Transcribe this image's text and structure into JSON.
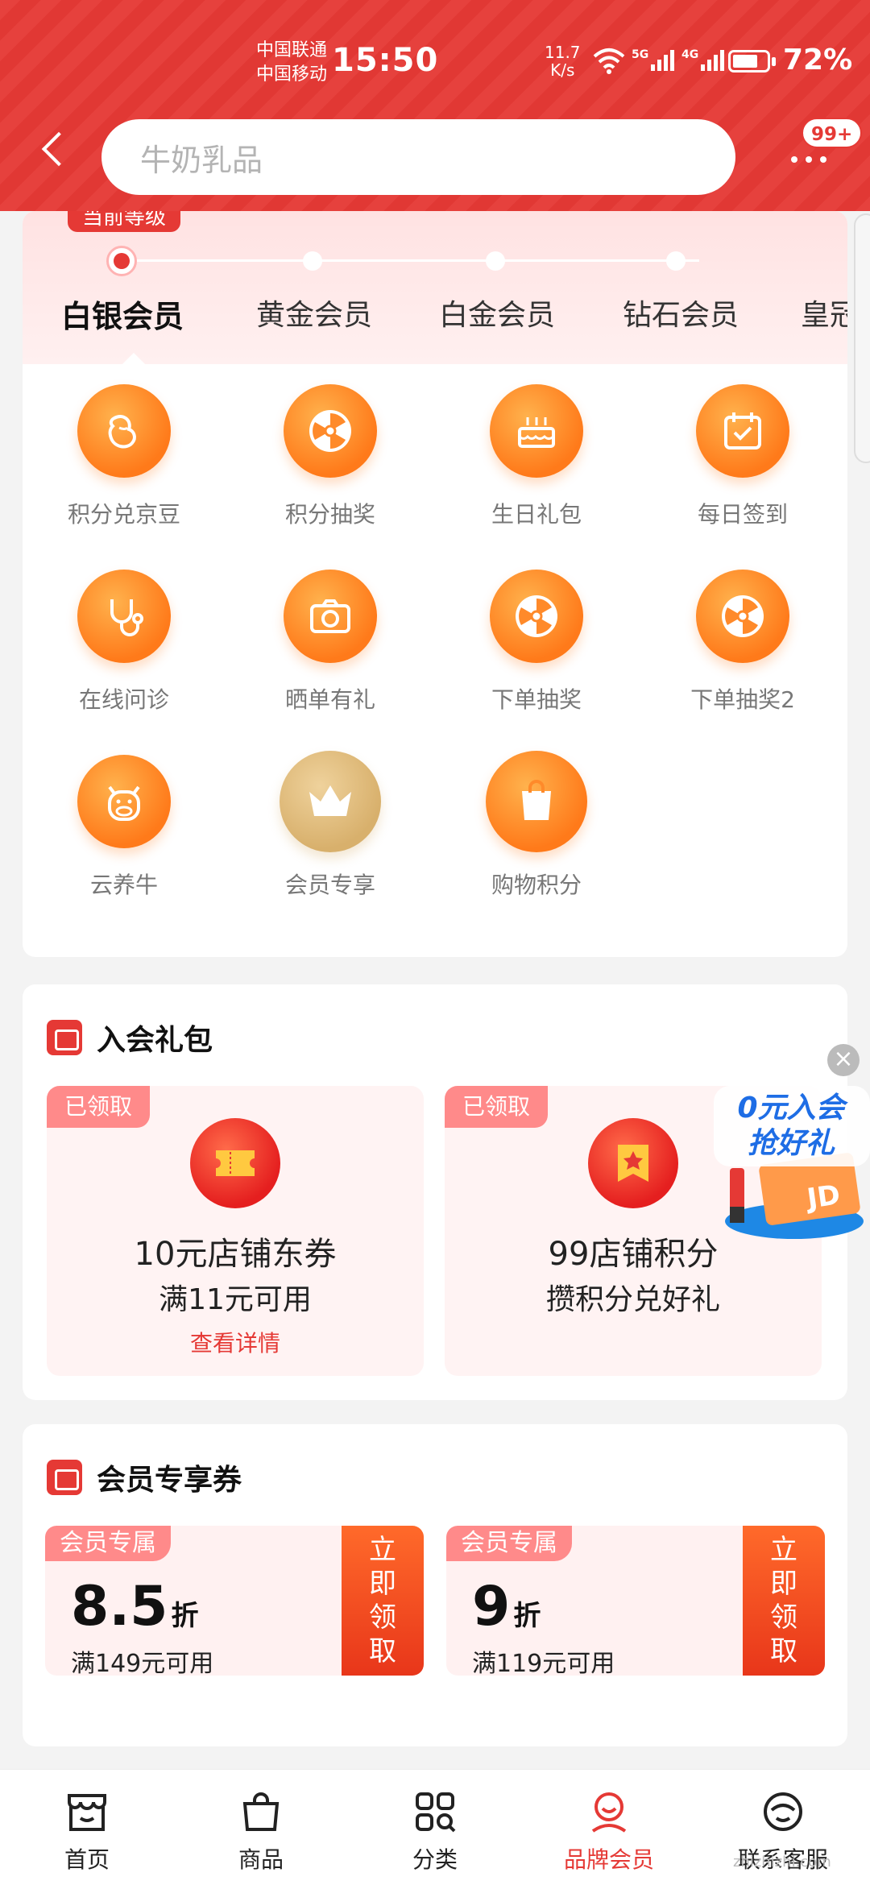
{
  "status_bar": {
    "carrier1": "中国联通",
    "carrier2": "中国移动",
    "time": "15:50",
    "speed": "11.7",
    "speed_unit": "K/s",
    "net1": "5G",
    "net2": "4G",
    "battery": "72%"
  },
  "header": {
    "search_placeholder": "牛奶乳品",
    "badge": "99+"
  },
  "levels": {
    "current_tag": "当前等级",
    "items": [
      "白银会员",
      "黄金会员",
      "白金会员",
      "钻石会员",
      "皇冠"
    ]
  },
  "benefits": [
    {
      "label": "积分兑京豆",
      "icon": "bean-icon"
    },
    {
      "label": "积分抽奖",
      "icon": "wheel-icon"
    },
    {
      "label": "生日礼包",
      "icon": "cake-icon"
    },
    {
      "label": "每日签到",
      "icon": "calendar-check-icon"
    },
    {
      "label": "在线问诊",
      "icon": "stethoscope-icon"
    },
    {
      "label": "晒单有礼",
      "icon": "camera-icon"
    },
    {
      "label": "下单抽奖",
      "icon": "wheel-icon"
    },
    {
      "label": "下单抽奖2",
      "icon": "wheel-icon"
    },
    {
      "label": "云养牛",
      "icon": "cow-icon"
    },
    {
      "label": "会员专享",
      "icon": "crown-icon"
    },
    {
      "label": "购物积分",
      "icon": "bag-icon"
    }
  ],
  "join_gift": {
    "title": "入会礼包",
    "items": [
      {
        "tag": "已领取",
        "title": "10元店铺东券",
        "subtitle": "满11元可用",
        "link": "查看详情"
      },
      {
        "tag": "已领取",
        "title": "99店铺积分",
        "subtitle": "攒积分兑好礼"
      }
    ]
  },
  "member_coupons": {
    "title": "会员专享券",
    "items": [
      {
        "tag": "会员专属",
        "value": "8.5",
        "unit": "折",
        "condition": "满149元可用",
        "button": "立即领取"
      },
      {
        "tag": "会员专属",
        "value": "9",
        "unit": "折",
        "condition": "满119元可用",
        "button": "立即领取"
      }
    ]
  },
  "floater": {
    "line1": "0元入会",
    "line2": "抢好礼",
    "logo": "JD"
  },
  "tabbar": {
    "items": [
      {
        "label": "首页",
        "icon": "store-icon"
      },
      {
        "label": "商品",
        "icon": "bag-icon"
      },
      {
        "label": "分类",
        "icon": "category-icon"
      },
      {
        "label": "品牌会员",
        "icon": "member-icon",
        "active": true
      },
      {
        "label": "联系客服",
        "icon": "service-icon"
      }
    ]
  },
  "watermark": "zhizhizhi.com",
  "colors": {
    "brand": "#e53935",
    "orange": "#ff7a1a",
    "gold": "#d8b06c"
  }
}
